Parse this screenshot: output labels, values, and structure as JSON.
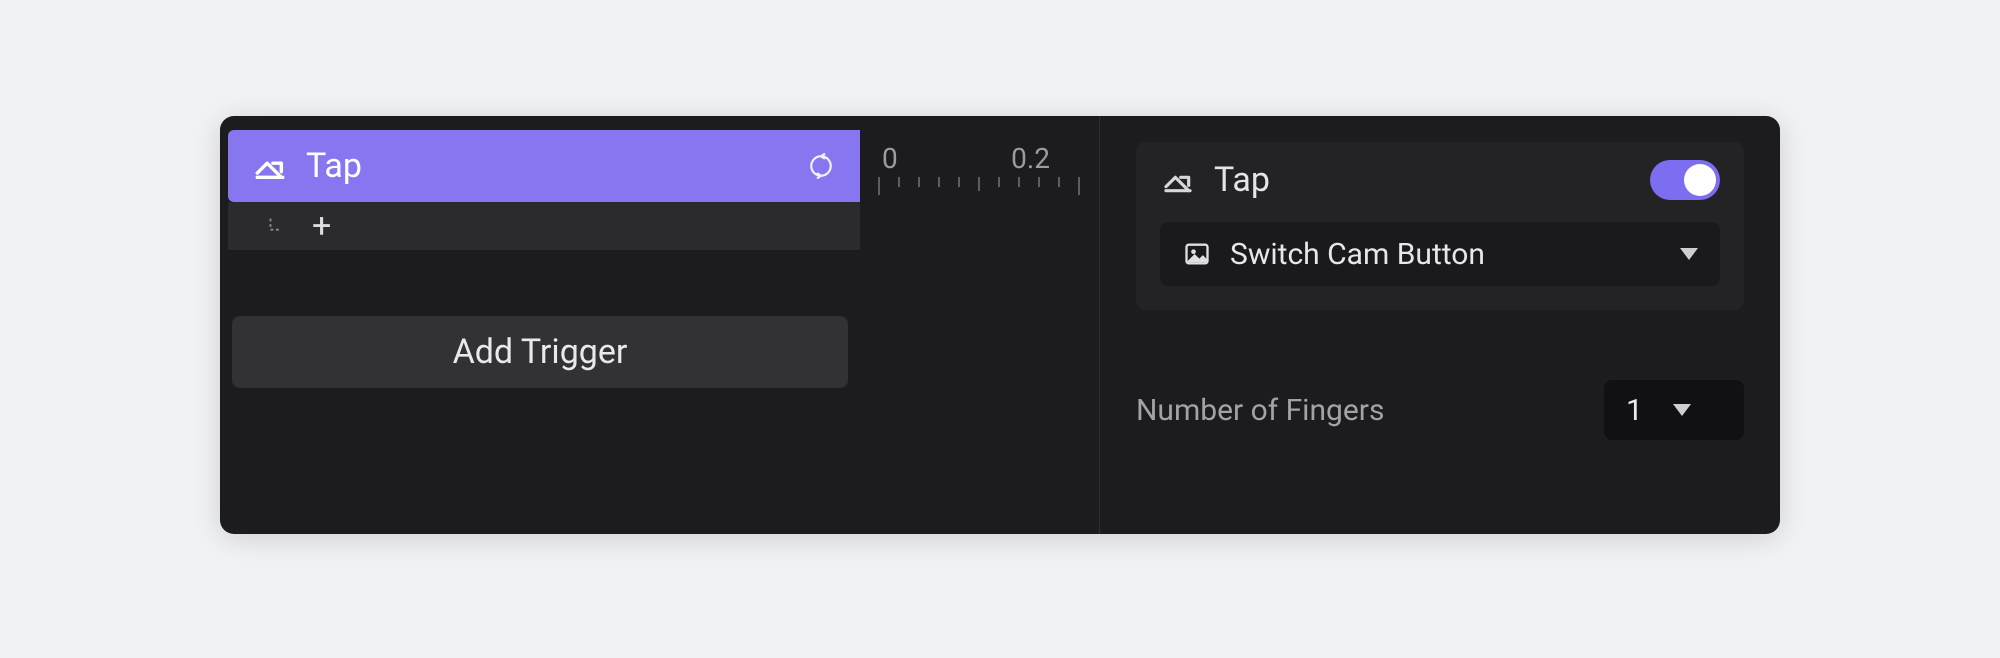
{
  "triggers": {
    "active": {
      "label": "Tap"
    },
    "add_button": "Add Trigger"
  },
  "ruler": {
    "ticks": [
      "0",
      "0.2"
    ]
  },
  "inspector": {
    "title": "Tap",
    "enabled": true,
    "target": {
      "label": "Switch Cam Button"
    },
    "props": {
      "fingers": {
        "label": "Number of Fingers",
        "value": "1"
      }
    }
  },
  "colors": {
    "accent": "#8677f0"
  }
}
